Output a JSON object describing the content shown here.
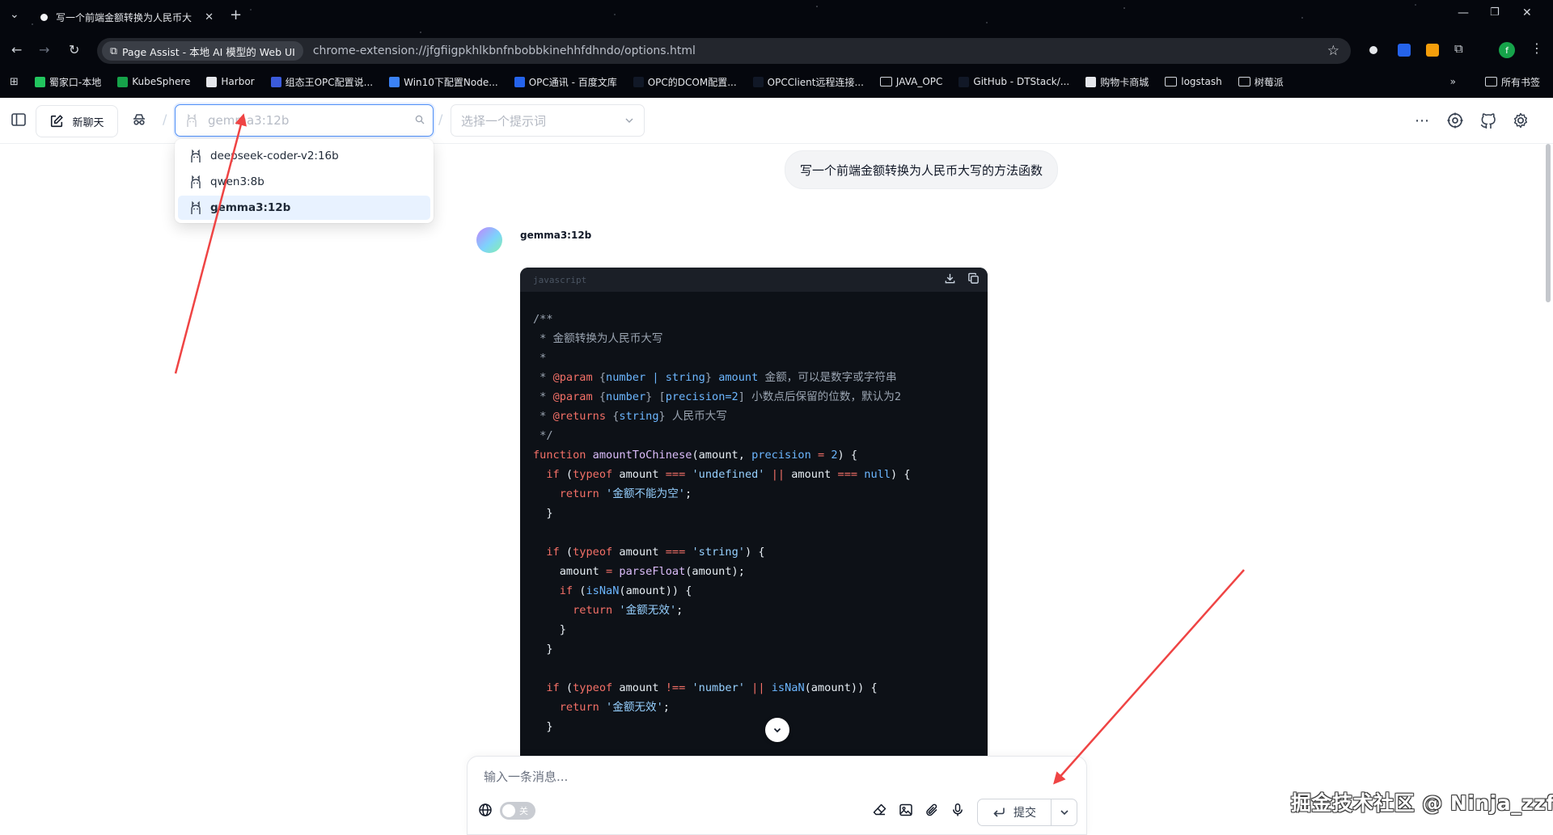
{
  "browser": {
    "tab_title": "写一个前端金额转换为人民币大",
    "site_chip": "Page Assist - 本地 AI 模型的 Web UI",
    "url": "chrome-extension://jfgfiigpkhlkbnfnbobbkinehhfdhndo/options.html",
    "bookmarks": [
      {
        "label": "蜀家口-本地",
        "icon_color": "#22c55e"
      },
      {
        "label": "KubeSphere",
        "icon_color": "#16a34a"
      },
      {
        "label": "Harbor",
        "icon_color": "#e5e7eb"
      },
      {
        "label": "组态王OPC配置说...",
        "icon_color": "#3b5bdb"
      },
      {
        "label": "Win10下配置Node...",
        "icon_color": "#3b82f6"
      },
      {
        "label": "OPC通讯 - 百度文库",
        "icon_color": "#2563eb"
      },
      {
        "label": "OPC的DCOM配置...",
        "icon_color": "#111827"
      },
      {
        "label": "OPCClient远程连接...",
        "icon_color": "#111827"
      },
      {
        "label": "JAVA_OPC",
        "icon_color": "folder"
      },
      {
        "label": "GitHub - DTStack/...",
        "icon_color": "#111827"
      },
      {
        "label": "购物卡商城",
        "icon_color": "#e5e7eb"
      },
      {
        "label": "logstash",
        "icon_color": "folder"
      },
      {
        "label": "树莓派",
        "icon_color": "folder"
      }
    ],
    "all_bookmarks": "所有书签",
    "profile_initial": "f"
  },
  "header": {
    "new_chat_label": "新聊天",
    "model_value": "gemma3:12b",
    "prompt_placeholder": "选择一个提示词"
  },
  "model_options": [
    {
      "label": "deepseek-coder-v2:16b",
      "selected": false
    },
    {
      "label": "qwen3:8b",
      "selected": false
    },
    {
      "label": "gemma3:12b",
      "selected": true
    }
  ],
  "chat": {
    "user_message": "写一个前端金额转换为人民币大写的方法函数",
    "bot_name": "gemma3:12b",
    "code_language": "javascript",
    "code_lines": [
      [
        {
          "t": "/**",
          "c": "c-com"
        }
      ],
      [
        {
          "t": " * 金额转换为人民币大写",
          "c": "c-com"
        }
      ],
      [
        {
          "t": " *",
          "c": "c-com"
        }
      ],
      [
        {
          "t": " * ",
          "c": "c-com"
        },
        {
          "t": "@param",
          "c": "c-tag"
        },
        {
          "t": " {",
          "c": "c-com"
        },
        {
          "t": "number | string",
          "c": "c-typ"
        },
        {
          "t": "} ",
          "c": "c-com"
        },
        {
          "t": "amount",
          "c": "c-typ"
        },
        {
          "t": " 金额，可以是数字或字符串",
          "c": "c-com"
        }
      ],
      [
        {
          "t": " * ",
          "c": "c-com"
        },
        {
          "t": "@param",
          "c": "c-tag"
        },
        {
          "t": " {",
          "c": "c-com"
        },
        {
          "t": "number",
          "c": "c-typ"
        },
        {
          "t": "} [",
          "c": "c-com"
        },
        {
          "t": "precision=2",
          "c": "c-typ"
        },
        {
          "t": "] 小数点后保留的位数，默认为2",
          "c": "c-com"
        }
      ],
      [
        {
          "t": " * ",
          "c": "c-com"
        },
        {
          "t": "@returns",
          "c": "c-tag"
        },
        {
          "t": " {",
          "c": "c-com"
        },
        {
          "t": "string",
          "c": "c-typ"
        },
        {
          "t": "} 人民币大写",
          "c": "c-com"
        }
      ],
      [
        {
          "t": " */",
          "c": "c-com"
        }
      ],
      [
        {
          "t": "function ",
          "c": "c-kw"
        },
        {
          "t": "amountToChinese",
          "c": "c-fn"
        },
        {
          "t": "(amount, ",
          "c": "c-var"
        },
        {
          "t": "precision",
          "c": "c-typ"
        },
        {
          "t": " = ",
          "c": "c-kw"
        },
        {
          "t": "2",
          "c": "c-num"
        },
        {
          "t": ") {",
          "c": "c-var"
        }
      ],
      [
        {
          "t": "  ",
          "c": "c-var"
        },
        {
          "t": "if",
          "c": "c-kw"
        },
        {
          "t": " (",
          "c": "c-var"
        },
        {
          "t": "typeof",
          "c": "c-kw"
        },
        {
          "t": " amount ",
          "c": "c-var"
        },
        {
          "t": "===",
          "c": "c-kw"
        },
        {
          "t": " ",
          "c": "c-var"
        },
        {
          "t": "'undefined'",
          "c": "c-str"
        },
        {
          "t": " ",
          "c": "c-var"
        },
        {
          "t": "||",
          "c": "c-kw"
        },
        {
          "t": " amount ",
          "c": "c-var"
        },
        {
          "t": "===",
          "c": "c-kw"
        },
        {
          "t": " ",
          "c": "c-var"
        },
        {
          "t": "null",
          "c": "c-num"
        },
        {
          "t": ") {",
          "c": "c-var"
        }
      ],
      [
        {
          "t": "    ",
          "c": "c-var"
        },
        {
          "t": "return",
          "c": "c-kw"
        },
        {
          "t": " ",
          "c": "c-var"
        },
        {
          "t": "'金额不能为空'",
          "c": "c-str"
        },
        {
          "t": ";",
          "c": "c-var"
        }
      ],
      [
        {
          "t": "  }",
          "c": "c-var"
        }
      ],
      [
        {
          "t": "",
          "c": "c-var"
        }
      ],
      [
        {
          "t": "  ",
          "c": "c-var"
        },
        {
          "t": "if",
          "c": "c-kw"
        },
        {
          "t": " (",
          "c": "c-var"
        },
        {
          "t": "typeof",
          "c": "c-kw"
        },
        {
          "t": " amount ",
          "c": "c-var"
        },
        {
          "t": "===",
          "c": "c-kw"
        },
        {
          "t": " ",
          "c": "c-var"
        },
        {
          "t": "'string'",
          "c": "c-str"
        },
        {
          "t": ") {",
          "c": "c-var"
        }
      ],
      [
        {
          "t": "    amount ",
          "c": "c-var"
        },
        {
          "t": "=",
          "c": "c-kw"
        },
        {
          "t": " ",
          "c": "c-var"
        },
        {
          "t": "parseFloat",
          "c": "c-fn"
        },
        {
          "t": "(amount);",
          "c": "c-var"
        }
      ],
      [
        {
          "t": "    ",
          "c": "c-var"
        },
        {
          "t": "if",
          "c": "c-kw"
        },
        {
          "t": " (",
          "c": "c-var"
        },
        {
          "t": "isNaN",
          "c": "c-typ"
        },
        {
          "t": "(amount)) {",
          "c": "c-var"
        }
      ],
      [
        {
          "t": "      ",
          "c": "c-var"
        },
        {
          "t": "return",
          "c": "c-kw"
        },
        {
          "t": " ",
          "c": "c-var"
        },
        {
          "t": "'金额无效'",
          "c": "c-str"
        },
        {
          "t": ";",
          "c": "c-var"
        }
      ],
      [
        {
          "t": "    }",
          "c": "c-var"
        }
      ],
      [
        {
          "t": "  }",
          "c": "c-var"
        }
      ],
      [
        {
          "t": "",
          "c": "c-var"
        }
      ],
      [
        {
          "t": "  ",
          "c": "c-var"
        },
        {
          "t": "if",
          "c": "c-kw"
        },
        {
          "t": " (",
          "c": "c-var"
        },
        {
          "t": "typeof",
          "c": "c-kw"
        },
        {
          "t": " amount ",
          "c": "c-var"
        },
        {
          "t": "!==",
          "c": "c-kw"
        },
        {
          "t": " ",
          "c": "c-var"
        },
        {
          "t": "'number'",
          "c": "c-str"
        },
        {
          "t": " ",
          "c": "c-var"
        },
        {
          "t": "||",
          "c": "c-kw"
        },
        {
          "t": " ",
          "c": "c-var"
        },
        {
          "t": "isNaN",
          "c": "c-typ"
        },
        {
          "t": "(amount)) {",
          "c": "c-var"
        }
      ],
      [
        {
          "t": "    ",
          "c": "c-var"
        },
        {
          "t": "return",
          "c": "c-kw"
        },
        {
          "t": " ",
          "c": "c-var"
        },
        {
          "t": "'金额无效'",
          "c": "c-str"
        },
        {
          "t": ";",
          "c": "c-var"
        }
      ],
      [
        {
          "t": "  }",
          "c": "c-var"
        }
      ]
    ]
  },
  "composer": {
    "placeholder": "输入一条消息...",
    "web_toggle_label": "关",
    "submit_label": "提交"
  },
  "watermark": "掘金技术社区 @ Ninja_zzf",
  "colors": {
    "accent": "#4f8ff7",
    "annotation_arrow": "#ef4444",
    "code_bg": "#0d1117"
  }
}
